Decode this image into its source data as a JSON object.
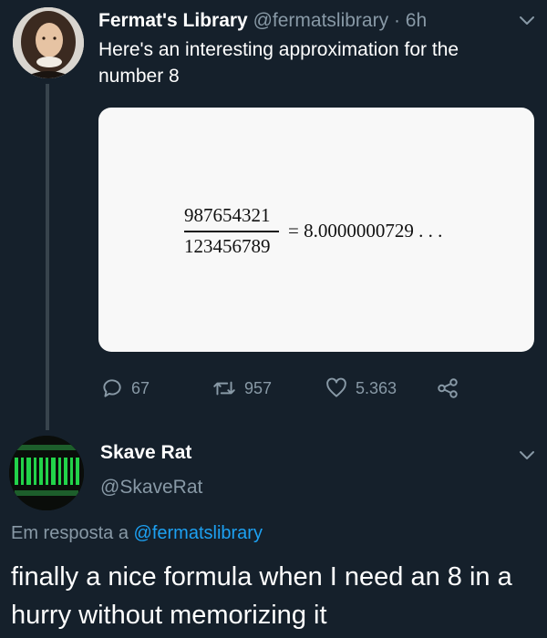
{
  "tweet": {
    "author_name": "Fermat's Library",
    "author_handle": "@fermatslibrary",
    "time": "· 6h",
    "text": "Here's an interesting approximation for the number 8",
    "media": {
      "numerator": "987654321",
      "denominator": "123456789",
      "result": "= 8.0000000729 . . ."
    },
    "actions": {
      "replies": "67",
      "retweets": "957",
      "likes": "5.363"
    }
  },
  "reply": {
    "author_name": "Skave Rat",
    "author_handle": "@SkaveRat",
    "context_prefix": "Em resposta a ",
    "context_mention": "@fermatslibrary",
    "text": "finally a nice formula when I need an 8 in a hurry without memorizing it"
  },
  "icons": {
    "reply": "speech-bubble-icon",
    "retweet": "retweet-icon",
    "like": "heart-icon",
    "share": "share-icon",
    "more": "chevron-down-icon"
  },
  "colors": {
    "background": "#15202b",
    "muted": "#8899a6",
    "link": "#1da1f2"
  }
}
